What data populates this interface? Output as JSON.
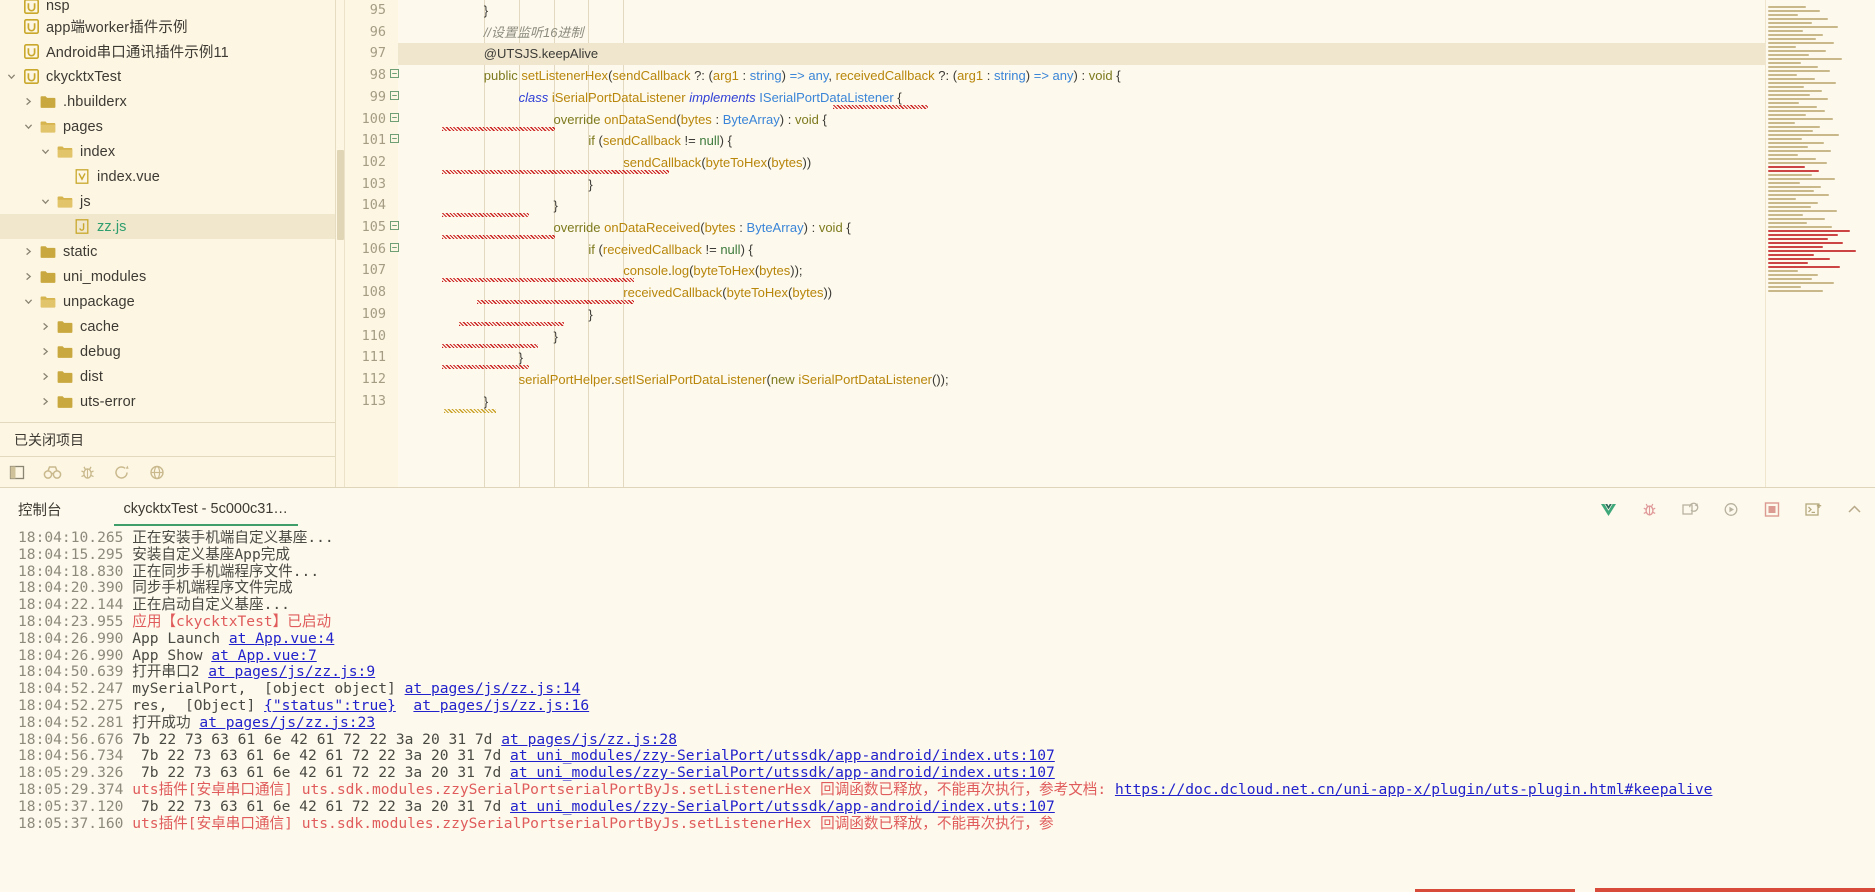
{
  "explorer": {
    "tree": [
      {
        "indent": 0,
        "twisty": "",
        "icon": "uniapp-project-icon",
        "label": "nsp",
        "selected": false,
        "partial": true
      },
      {
        "indent": 0,
        "twisty": "",
        "icon": "uniapp-project-icon",
        "label": "app端worker插件示例",
        "selected": false
      },
      {
        "indent": 0,
        "twisty": "",
        "icon": "uniapp-project-icon",
        "label": "Android串口通讯插件示例11",
        "selected": false
      },
      {
        "indent": 0,
        "twisty": "down",
        "icon": "uniapp-project-icon",
        "label": "ckycktxTest",
        "selected": false
      },
      {
        "indent": 1,
        "twisty": "right",
        "icon": "folder-icon",
        "label": ".hbuilderx",
        "selected": false
      },
      {
        "indent": 1,
        "twisty": "down",
        "icon": "folder-open-icon",
        "label": "pages",
        "selected": false
      },
      {
        "indent": 2,
        "twisty": "down",
        "icon": "folder-open-icon",
        "label": "index",
        "selected": false
      },
      {
        "indent": 3,
        "twisty": "",
        "icon": "vue-file-icon",
        "label": "index.vue",
        "selected": false
      },
      {
        "indent": 2,
        "twisty": "down",
        "icon": "folder-open-icon",
        "label": "js",
        "selected": false
      },
      {
        "indent": 3,
        "twisty": "",
        "icon": "js-file-icon",
        "label": "zz.js",
        "selected": true,
        "js": true
      },
      {
        "indent": 1,
        "twisty": "right",
        "icon": "folder-icon",
        "label": "static",
        "selected": false
      },
      {
        "indent": 1,
        "twisty": "right",
        "icon": "folder-icon",
        "label": "uni_modules",
        "selected": false
      },
      {
        "indent": 1,
        "twisty": "down",
        "icon": "folder-open-icon",
        "label": "unpackage",
        "selected": false
      },
      {
        "indent": 2,
        "twisty": "right",
        "icon": "folder-icon",
        "label": "cache",
        "selected": false
      },
      {
        "indent": 2,
        "twisty": "right",
        "icon": "folder-icon",
        "label": "debug",
        "selected": false
      },
      {
        "indent": 2,
        "twisty": "right",
        "icon": "folder-icon",
        "label": "dist",
        "selected": false
      },
      {
        "indent": 2,
        "twisty": "right",
        "icon": "folder-icon",
        "label": "uts-error",
        "selected": false
      }
    ],
    "closed_projects_label": "已关闭项目",
    "toolbar_icons": [
      "panel-toggle-icon",
      "binoculars-icon",
      "bug-icon",
      "refresh-icon",
      "globe-icon"
    ]
  },
  "editor": {
    "first_line": 95,
    "highlight_line": 97,
    "lines": [
      {
        "n": 95,
        "fold": "",
        "indent": 8,
        "text": "}"
      },
      {
        "n": 96,
        "fold": "",
        "indent": 8,
        "text": "//设置监听16进制"
      },
      {
        "n": 97,
        "fold": "",
        "indent": 8,
        "text": "@UTSJS.keepAlive"
      },
      {
        "n": 98,
        "fold": "-",
        "indent": 8,
        "text": "public setListenerHex(sendCallback ?: (arg1 : string) => any, receivedCallback ?: (arg1 : string) => any) : void {"
      },
      {
        "n": 99,
        "fold": "-",
        "indent": 12,
        "text": "class iSerialPortDataListener implements ISerialPortDataListener {"
      },
      {
        "n": 100,
        "fold": "-",
        "indent": 16,
        "text": "override onDataSend(bytes : ByteArray) : void {"
      },
      {
        "n": 101,
        "fold": "-",
        "indent": 20,
        "text": "if (sendCallback != null) {"
      },
      {
        "n": 102,
        "fold": "",
        "indent": 24,
        "text": "sendCallback(byteToHex(bytes))"
      },
      {
        "n": 103,
        "fold": "",
        "indent": 20,
        "text": "}"
      },
      {
        "n": 104,
        "fold": "",
        "indent": 16,
        "text": "}"
      },
      {
        "n": 105,
        "fold": "-",
        "indent": 16,
        "text": "override onDataReceived(bytes : ByteArray) : void {"
      },
      {
        "n": 106,
        "fold": "-",
        "indent": 20,
        "text": "if (receivedCallback != null) {"
      },
      {
        "n": 107,
        "fold": "",
        "indent": 24,
        "text": "console.log(byteToHex(bytes));"
      },
      {
        "n": 108,
        "fold": "",
        "indent": 24,
        "text": "receivedCallback(byteToHex(bytes))"
      },
      {
        "n": 109,
        "fold": "",
        "indent": 20,
        "text": "}"
      },
      {
        "n": 110,
        "fold": "",
        "indent": 16,
        "text": "}"
      },
      {
        "n": 111,
        "fold": "",
        "indent": 12,
        "text": "}"
      },
      {
        "n": 112,
        "fold": "",
        "indent": 12,
        "text": "serialPortHelper.setISerialPortDataListener(new iSerialPortDataListener());"
      },
      {
        "n": 113,
        "fold": "",
        "indent": 8,
        "text": "}"
      }
    ]
  },
  "console": {
    "title": "控制台",
    "tab_label": "ckycktxTest - 5c000c31…",
    "actions": [
      "vue-devtools-icon",
      "bug-icon",
      "reload-icon",
      "run-icon",
      "stop-icon",
      "terminal-icon",
      "collapse-icon"
    ],
    "logs": [
      {
        "time": "18:04:10.265",
        "parts": [
          {
            "t": "正在安装手机端自定义基座...",
            "s": "plain"
          }
        ]
      },
      {
        "time": "18:04:15.295",
        "parts": [
          {
            "t": "安装自定义基座App完成",
            "s": "plain"
          }
        ]
      },
      {
        "time": "18:04:18.830",
        "parts": [
          {
            "t": "正在同步手机端程序文件...",
            "s": "plain"
          }
        ]
      },
      {
        "time": "18:04:20.390",
        "parts": [
          {
            "t": "同步手机端程序文件完成",
            "s": "plain"
          }
        ]
      },
      {
        "time": "18:04:22.144",
        "parts": [
          {
            "t": "正在启动自定义基座...",
            "s": "plain"
          }
        ]
      },
      {
        "time": "18:04:23.955",
        "parts": [
          {
            "t": "应用【ckycktxTest】已启动",
            "s": "err"
          }
        ]
      },
      {
        "time": "18:04:26.990",
        "parts": [
          {
            "t": "App Launch ",
            "s": "plain"
          },
          {
            "t": "at App.vue:4",
            "s": "lk"
          }
        ]
      },
      {
        "time": "18:04:26.990",
        "parts": [
          {
            "t": "App Show ",
            "s": "plain"
          },
          {
            "t": "at App.vue:7",
            "s": "lk"
          }
        ]
      },
      {
        "time": "18:04:50.639",
        "parts": [
          {
            "t": "打开串口2 ",
            "s": "plain"
          },
          {
            "t": "at pages/js/zz.js:9",
            "s": "lk"
          }
        ]
      },
      {
        "time": "18:04:52.247",
        "parts": [
          {
            "t": "mySerialPort,  [object object] ",
            "s": "plain"
          },
          {
            "t": "at pages/js/zz.js:14",
            "s": "lk"
          }
        ]
      },
      {
        "time": "18:04:52.275",
        "parts": [
          {
            "t": "res,  [Object] ",
            "s": "plain"
          },
          {
            "t": "{\"status\":true}",
            "s": "obj"
          },
          {
            "t": "  ",
            "s": "plain"
          },
          {
            "t": "at pages/js/zz.js:16",
            "s": "lk"
          }
        ]
      },
      {
        "time": "18:04:52.281",
        "parts": [
          {
            "t": "打开成功 ",
            "s": "plain"
          },
          {
            "t": "at pages/js/zz.js:23",
            "s": "lk"
          }
        ]
      },
      {
        "time": "18:04:56.676",
        "parts": [
          {
            "t": "7b 22 73 63 61 6e 42 61 72 22 3a 20 31 7d ",
            "s": "plain"
          },
          {
            "t": "at pages/js/zz.js:28",
            "s": "lk"
          }
        ]
      },
      {
        "time": "18:04:56.734",
        "parts": [
          {
            "t": " 7b 22 73 63 61 6e 42 61 72 22 3a 20 31 7d ",
            "s": "plain"
          },
          {
            "t": "at uni_modules/zzy-SerialPort/utssdk/app-android/index.uts:107",
            "s": "lk"
          }
        ]
      },
      {
        "time": "18:05:29.326",
        "parts": [
          {
            "t": " 7b 22 73 63 61 6e 42 61 72 22 3a 20 31 7d ",
            "s": "plain"
          },
          {
            "t": "at uni_modules/zzy-SerialPort/utssdk/app-android/index.uts:107",
            "s": "lk"
          }
        ]
      },
      {
        "time": "18:05:29.374",
        "parts": [
          {
            "t": "uts插件[安卓串口通信] uts.sdk.modules.zzySerialPortserialPortByJs.setListenerHex ",
            "s": "err"
          },
          {
            "t": "回调函数已释放，不能再次执行，参考文档: ",
            "s": "err"
          },
          {
            "t": "https://doc.dcloud.net.cn/uni-app-x/plugin/uts-plugin.html#keepalive",
            "s": "lk"
          }
        ]
      },
      {
        "time": "18:05:37.120",
        "parts": [
          {
            "t": " 7b 22 73 63 61 6e 42 61 72 22 3a 20 31 7d ",
            "s": "plain"
          },
          {
            "t": "at uni_modules/zzy-SerialPort/utssdk/app-android/index.uts:107",
            "s": "lk"
          }
        ]
      },
      {
        "time": "18:05:37.160",
        "parts": [
          {
            "t": "uts插件[安卓串口通信] uts.sdk.modules.zzySerialPortserialPortByJs.setListenerHex ",
            "s": "err"
          },
          {
            "t": "回调函数已释放，不能再次执行，参",
            "s": "err"
          }
        ]
      }
    ]
  },
  "colors": {
    "background": "#fdf6e3",
    "editor_background": "#fdf9ec",
    "selection": "#f0e7cd",
    "accent_green": "#3f9e6a",
    "link_blue": "#2222cc",
    "error_red": "#e05c5c",
    "red_accent": "#d84a3a"
  }
}
